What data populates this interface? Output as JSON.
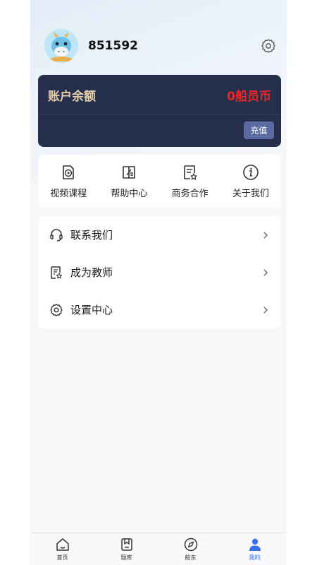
{
  "user": {
    "name": "851592"
  },
  "balance": {
    "label": "账户余额",
    "value": "0船员币",
    "recharge_label": "充值"
  },
  "quick_links": [
    {
      "label": "视频课程",
      "icon": "video-icon"
    },
    {
      "label": "帮助中心",
      "icon": "help-book-icon"
    },
    {
      "label": "商务合作",
      "icon": "document-star-icon"
    },
    {
      "label": "关于我们",
      "icon": "info-icon"
    }
  ],
  "menu": [
    {
      "label": "联系我们",
      "icon": "headset-icon"
    },
    {
      "label": "成为教师",
      "icon": "document-star-icon"
    },
    {
      "label": "设置中心",
      "icon": "gear-icon"
    }
  ],
  "tabbar": [
    {
      "label": "首页",
      "icon": "home-icon"
    },
    {
      "label": "题库",
      "icon": "question-bank-icon"
    },
    {
      "label": "船东",
      "icon": "compass-icon"
    },
    {
      "label": "我的",
      "icon": "user-icon",
      "active": true
    }
  ],
  "colors": {
    "card_bg": "#252f4c",
    "balance_label": "#e5cfa8",
    "balance_value": "#e8272b",
    "accent": "#3a6ff0",
    "recharge_bg": "#5b6aa3"
  }
}
